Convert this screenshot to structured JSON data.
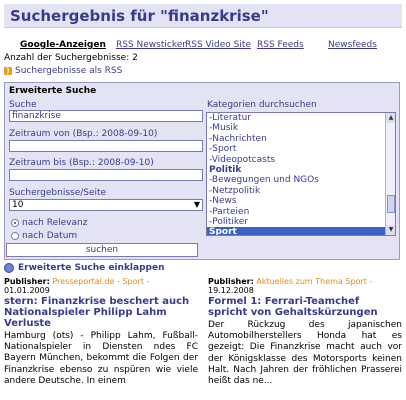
{
  "header": {
    "title": "Suchergebnis für \"finanzkrise\""
  },
  "tabs": [
    {
      "label": "Google-Anzeigen",
      "active": true
    },
    {
      "label": "RSS Newsticker",
      "active": false
    },
    {
      "label": "RSS Video Site",
      "active": false
    },
    {
      "label": "RSS Feeds",
      "active": false
    },
    {
      "label": "Newsfeeds",
      "active": false
    }
  ],
  "results_count": "Anzahl der Suchergebnisse: 2",
  "rss_link": "Suchergebnisse als RSS",
  "advanced_search": {
    "title": "Erweiterte Suche",
    "search_label": "Suche",
    "search_value": "finanzkrise",
    "from_label": "Zeitraum von (Bsp.: 2008-09-10)",
    "from_value": "",
    "to_label": "Zeitraum bis (Bsp.: 2008-09-10)",
    "to_value": "",
    "per_page_label": "Suchergebnisse/Seite",
    "per_page_value": "10",
    "sort_relevance": "nach Relevanz",
    "sort_date": "nach Datum",
    "submit_label": "suchen",
    "categories_label": "Kategorien durchsuchen",
    "categories": [
      {
        "label": "-Literatur",
        "type": "item"
      },
      {
        "label": "-Musik",
        "type": "item"
      },
      {
        "label": "-Nachrichten",
        "type": "item"
      },
      {
        "label": "-Sport",
        "type": "item"
      },
      {
        "label": "-Videopotcasts",
        "type": "item"
      },
      {
        "label": "Politik",
        "type": "group"
      },
      {
        "label": "-Bewegungen und NGOs",
        "type": "item"
      },
      {
        "label": "-Netzpolitik",
        "type": "item"
      },
      {
        "label": "-News",
        "type": "item"
      },
      {
        "label": "-Parteien",
        "type": "item"
      },
      {
        "label": "-Politiker",
        "type": "item"
      },
      {
        "label": "Sport",
        "type": "selected"
      }
    ]
  },
  "collapse_link": "Erweiterte Suche einklappen",
  "results": [
    {
      "publisher_label": "Publisher:",
      "source": "Presseportal.de - Sport -",
      "date": "01.01.2009",
      "title": "stern: Finanzkrise beschert auch Nationalspieler Philipp Lahm Verluste",
      "body": "Hamburg (ots) - Philipp Lahm, Fußball-Nationalspieler in Diensten ndes FC Bayern München, bekommt die Folgen der Finanzkrise ebenso zu nspüren wie viele andere Deutsche. In einem"
    },
    {
      "publisher_label": "Publisher:",
      "source": "Aktuelles zum Thema Sport -",
      "date": "19.12.2008",
      "title": "Formel 1: Ferrari-Teamchef spricht von Gehaltskürzungen",
      "body": "Der Rückzug des japanischen Automobilherstellers Honda hat es gezeigt: Die Finanzkrise macht auch vor der Königsklasse des Motorsports keinen Halt. Nach Jahren der fröhlichen Prasserei heißt das ne..."
    }
  ]
}
